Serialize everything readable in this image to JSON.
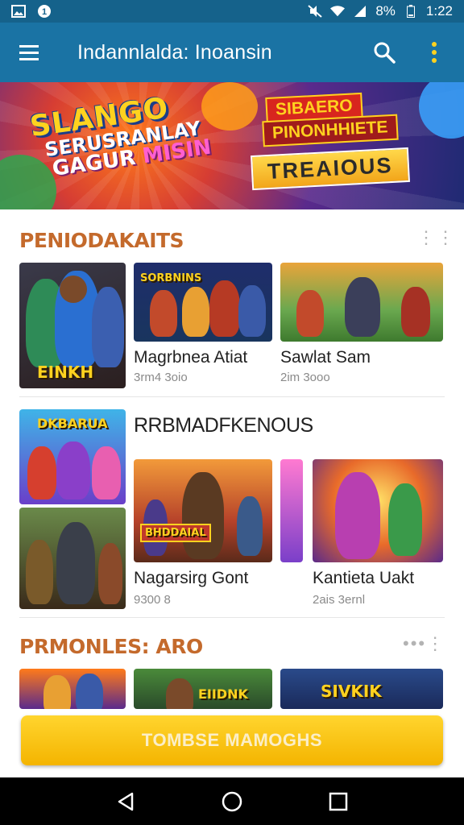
{
  "status_bar": {
    "battery": "8%",
    "time": "1:22",
    "icons": [
      "gallery-icon",
      "notification-1-icon",
      "mute-icon",
      "wifi-icon",
      "signal-icon",
      "battery-icon"
    ]
  },
  "app_bar": {
    "title": "Indannlalda: Inoansin",
    "icons": [
      "menu-icon",
      "search-icon",
      "overflow-menu-icon"
    ]
  },
  "hero": {
    "left_line1": "SLANGO",
    "left_line2": "SERUSRANLAY",
    "left_line3a": "GAGUR",
    "left_line3b": "MISIN",
    "plaque1": "SIBAERO",
    "plaque2": "PINONHHIETE",
    "plaque3": "TREAIOUS"
  },
  "section1": {
    "title": "PENIODAKAITS",
    "cards": [
      {
        "badge": "EINKH",
        "title": "",
        "meta": ""
      },
      {
        "badge": "SORBNINS",
        "title": "Magrbnea Atiat",
        "meta": "3rm4 3oio"
      },
      {
        "badge": "",
        "title": "Sawlat Sam",
        "meta": "2im 3ooo"
      }
    ]
  },
  "section2": {
    "title": "RRBMADFKENOUS",
    "cards": [
      {
        "badge": "DKBARUA",
        "title": "",
        "meta": ""
      },
      {
        "badge": "",
        "title": "",
        "meta": ""
      },
      {
        "badge": "BHDDAIAL",
        "title": "Nagarsirg Gont",
        "meta": "9300 8"
      },
      {
        "badge": "",
        "title": "Kantieta Uakt",
        "meta": "2ais 3ernl"
      }
    ]
  },
  "section3": {
    "title": "PRMONLES: ARO",
    "cards": [
      {
        "badge": ""
      },
      {
        "badge": "EIIDNK"
      },
      {
        "badge": "SIVKIK"
      }
    ]
  },
  "cta": {
    "label": "TOMBSE MAMOGHS"
  },
  "colors": {
    "appbar": "#1a73a4",
    "statusbar": "#15628b",
    "section_title": "#c46a2c",
    "cta": "#f4b400"
  },
  "nav": [
    "back-icon",
    "home-icon",
    "recents-icon"
  ]
}
